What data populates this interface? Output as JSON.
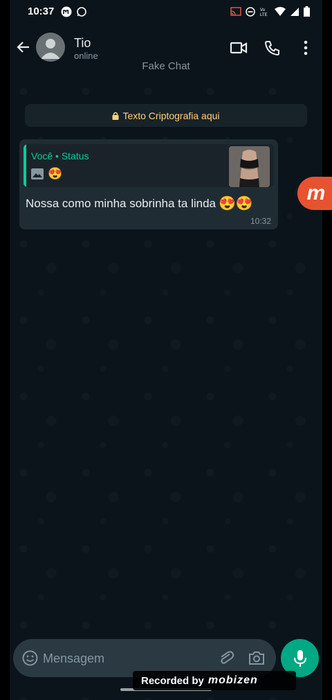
{
  "status_bar": {
    "time": "10:37"
  },
  "header": {
    "contact_name": "Tio",
    "contact_status": "online",
    "subtitle": "Fake Chat"
  },
  "encryption_notice": {
    "text": "Texto Criptografia aqui"
  },
  "message": {
    "quote_title": "Você • Status",
    "quote_emoji": "😍",
    "text": "Nossa como minha sobrinha ta linda",
    "emojis": "😍😍",
    "time": "10:32"
  },
  "composer": {
    "placeholder": "Mensagem"
  },
  "overlay": {
    "recorded_by": "Recorded by",
    "brand": "mobizen",
    "floating_badge": "m"
  },
  "colors": {
    "background": "#0b141a",
    "bubble": "#202c33",
    "accent": "#00a884",
    "quote_accent": "#06cf9c",
    "encryption_text": "#ffd279",
    "recorder_badge": "#e8532f"
  }
}
